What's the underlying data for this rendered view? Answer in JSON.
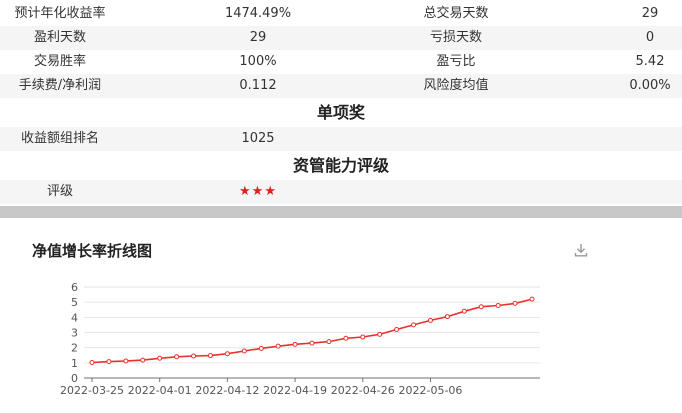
{
  "stats": {
    "rows": [
      {
        "label1": "预计年化收益率",
        "value1": "1474.49%",
        "label2": "总交易天数",
        "value2": "29"
      },
      {
        "label1": "盈利天数",
        "value1": "29",
        "label2": "亏损天数",
        "value2": "0"
      },
      {
        "label1": "交易胜率",
        "value1": "100%",
        "label2": "盈亏比",
        "value2": "5.42"
      },
      {
        "label1": "手续费/净利润",
        "value1": "0.112",
        "label2": "风险度均值",
        "value2": "0.00%"
      }
    ]
  },
  "award": {
    "title": "单项奖",
    "label": "收益额组排名",
    "value": "1025"
  },
  "rating": {
    "title": "资管能力评级",
    "label": "评级",
    "stars": "★★★"
  },
  "chart": {
    "title": "净值增长率折线图",
    "download_icon": "download-icon",
    "line_color": "#e8322b",
    "grid_color": "#e6e6e6"
  },
  "chart_data": {
    "type": "line",
    "title": "净值增长率折线图",
    "xlabel": "",
    "ylabel": "",
    "ylim": [
      0,
      6
    ],
    "yticks": [
      0,
      1,
      2,
      3,
      4,
      5,
      6
    ],
    "xtick_labels": [
      "2022-03-25",
      "2022-04-01",
      "2022-04-12",
      "2022-04-19",
      "2022-04-26",
      "2022-05-06"
    ],
    "xtick_index": [
      0,
      4,
      8,
      12,
      16,
      20
    ],
    "grid": true,
    "series": [
      {
        "values": [
          1.02,
          1.08,
          1.12,
          1.18,
          1.3,
          1.4,
          1.45,
          1.48,
          1.6,
          1.78,
          1.95,
          2.1,
          2.22,
          2.3,
          2.4,
          2.62,
          2.7,
          2.88,
          3.2,
          3.5,
          3.8,
          4.05,
          4.4,
          4.7,
          4.78,
          4.92,
          5.2
        ]
      }
    ]
  }
}
